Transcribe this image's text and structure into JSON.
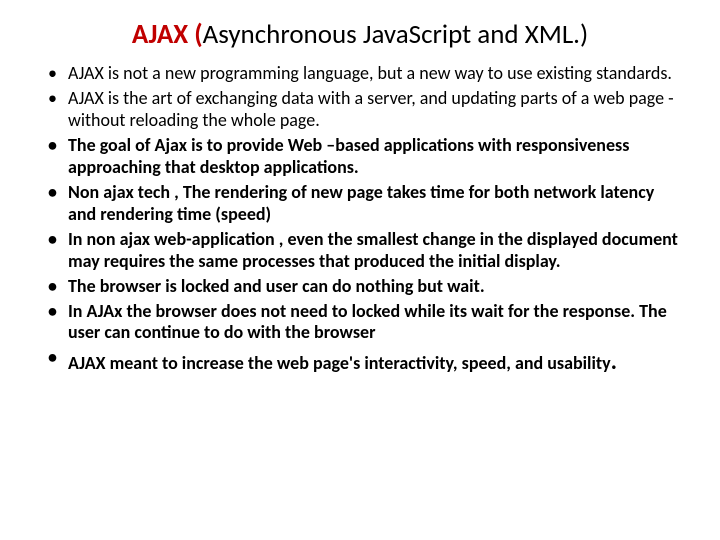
{
  "title": {
    "red_part": "AJAX (",
    "rest_part": "Asynchronous JavaScript and XML",
    "closing": ".)"
  },
  "bullets": [
    {
      "text": "AJAX is not a new programming language, but a new way to use existing standards.",
      "bold": false
    },
    {
      "text": "AJAX is the art of exchanging data with a server, and updating parts of a web page - without reloading the whole page.",
      "bold": false
    },
    {
      "text": "The goal of Ajax is to provide  Web –based applications with responsiveness  approaching that desktop applications.",
      "bold": true
    },
    {
      "text": "Non ajax tech , The rendering of new page  takes time for  both network latency and rendering time (speed)",
      "bold": true
    },
    {
      "text": "In non ajax web-application , even the smallest change in the displayed document may requires the same processes that produced the initial display.",
      "bold": true
    },
    {
      "text": "The browser is locked and user can do nothing but wait.",
      "bold": true
    },
    {
      "text": "In AJAx  the browser does not need to locked while its wait for the response. The user can continue to do with the browser",
      "bold": true
    },
    {
      "text": "AJAX meant to increase the web page's interactivity, speed, and usability",
      "bold": true,
      "big_period": true
    }
  ]
}
